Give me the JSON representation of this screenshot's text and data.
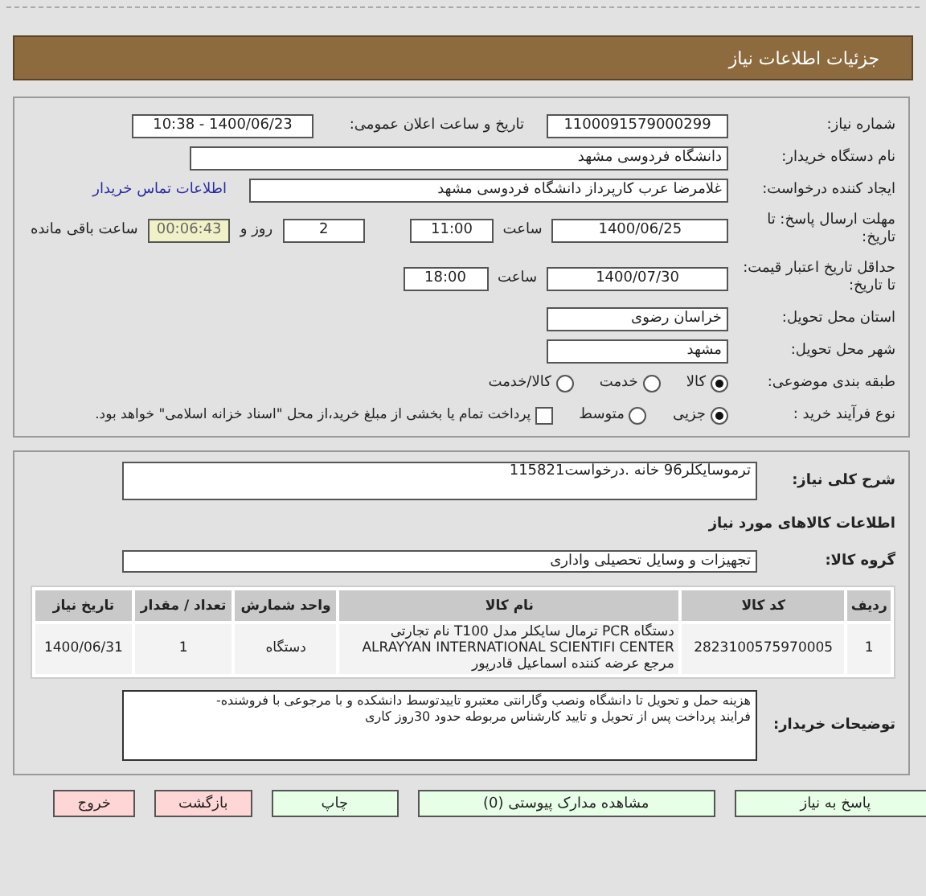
{
  "header": {
    "title": "جزئیات اطلاعات نیاز"
  },
  "info": {
    "need_number": {
      "label": "شماره نیاز:",
      "value": "1100091579000299"
    },
    "announce": {
      "label": "تاریخ و ساعت اعلان عمومی:",
      "value": "1400/06/23 - 10:38"
    },
    "buyer": {
      "label": "نام دستگاه خریدار:",
      "value": "دانشگاه فردوسی مشهد"
    },
    "creator": {
      "label": "ایجاد کننده درخواست:",
      "value": "غلامرضا عرب کارپرداز دانشگاه فردوسی مشهد",
      "link": "اطلاعات تماس خریدار"
    },
    "deadline": {
      "label": "مهلت ارسال پاسخ: تا تاریخ:",
      "date": "1400/06/25",
      "time_label": "ساعت",
      "time": "11:00",
      "days": "2",
      "days_label": "روز و",
      "remaining": "00:06:43",
      "remaining_label": "ساعت باقی مانده"
    },
    "validity": {
      "label": "حداقل تاریخ اعتبار قیمت: تا تاریخ:",
      "date": "1400/07/30",
      "time_label": "ساعت",
      "time": "18:00"
    },
    "province": {
      "label": "استان محل تحویل:",
      "value": "خراسان رضوی"
    },
    "city": {
      "label": "شهر محل تحویل:",
      "value": "مشهد"
    },
    "category": {
      "label": "طبقه بندی موضوعی:",
      "options": [
        {
          "label": "کالا",
          "selected": true
        },
        {
          "label": "خدمت",
          "selected": false
        },
        {
          "label": "کالا/خدمت",
          "selected": false
        }
      ]
    },
    "purchase_type": {
      "label": "نوع فرآیند خرید :",
      "options": [
        {
          "label": "جزیی",
          "selected": true
        },
        {
          "label": "متوسط",
          "selected": false
        }
      ],
      "payment": {
        "label": "پرداخت تمام یا بخشی از مبلغ خرید،از محل \"اسناد خزانه اسلامی\" خواهد بود.",
        "checked": false
      }
    }
  },
  "details": {
    "description": {
      "label": "شرح کلی نیاز:",
      "value": "ترموسایکلر96 خانه .درخواست115821"
    },
    "goods_heading": "اطلاعات کالاهای مورد نیاز",
    "group": {
      "label": "گروه کالا:",
      "value": "تجهیزات و وسایل تحصیلی واداری"
    },
    "table": {
      "columns": [
        "ردیف",
        "کد کالا",
        "نام کالا",
        "واحد شمارش",
        "تعداد / مقدار",
        "تاریخ نیاز"
      ],
      "rows": [
        [
          "1",
          "2823100575970005",
          "دستگاه PCR ترمال سایکلر مدل T100 نام تجارتی ALRAYYAN INTERNATIONAL SCIENTIFI CENTER مرجع عرضه کننده اسماعیل قادرپور",
          "دستگاه",
          "1",
          "1400/06/31"
        ]
      ]
    },
    "notes": {
      "label": "توضیحات خریدار:",
      "lines": [
        "هزینه حمل و تحویل تا دانشگاه ونصب وگارانتی معتبرو تاییدتوسط دانشکده و با مرجوعی با فروشنده-",
        "فرایند پرداخت پس از تحویل و تایید کارشناس مربوطه حدود 30روز کاری"
      ]
    }
  },
  "buttons": [
    {
      "label": "پاسخ به نیاز",
      "kind": "normal"
    },
    {
      "label": "مشاهده مدارک پیوستی (0)",
      "kind": "normal"
    },
    {
      "label": "چاپ",
      "kind": "normal"
    },
    {
      "label": "بازگشت",
      "kind": "exit"
    },
    {
      "label": "خروج",
      "kind": "exit"
    }
  ]
}
